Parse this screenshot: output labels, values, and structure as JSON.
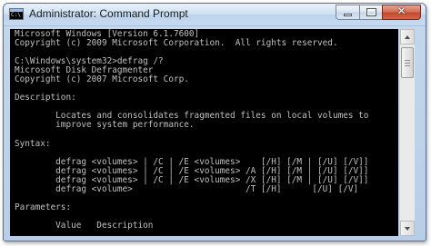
{
  "window": {
    "title": "Administrator: Command Prompt",
    "close_glyph": "✕"
  },
  "console": {
    "lines": [
      "Microsoft Windows [Version 6.1.7600]",
      "Copyright (c) 2009 Microsoft Corporation.  All rights reserved.",
      "",
      "C:\\Windows\\system32>defrag /?",
      "Microsoft Disk Defragmenter",
      "Copyright (c) 2007 Microsoft Corp.",
      "",
      "Description:",
      "",
      "        Locates and consolidates fragmented files on local volumes to",
      "        improve system performance.",
      "",
      "Syntax:",
      "",
      "        defrag <volumes> | /C | /E <volumes>    [/H] [/M | [/U] [/V]]",
      "        defrag <volumes> | /C | /E <volumes> /A [/H] [/M | [/U] [/V]]",
      "        defrag <volumes> | /C | /E <volumes> /X [/H] [/M | [/U] [/V]]",
      "        defrag <volume>                      /T [/H]      [/U] [/V]",
      "",
      "Parameters:",
      "",
      "        Value   Description"
    ]
  },
  "icons": {
    "app": "command-prompt-icon",
    "minimize": "minimize-icon",
    "maximize": "maximize-icon",
    "close": "close-icon",
    "scroll_up": "scroll-up-arrow-icon",
    "scroll_down": "scroll-down-arrow-icon"
  },
  "colors": {
    "console_background": "#000000",
    "console_text": "#c0c0c0",
    "close_button": "#c24a2f",
    "title_bar": "#c6daf0"
  }
}
